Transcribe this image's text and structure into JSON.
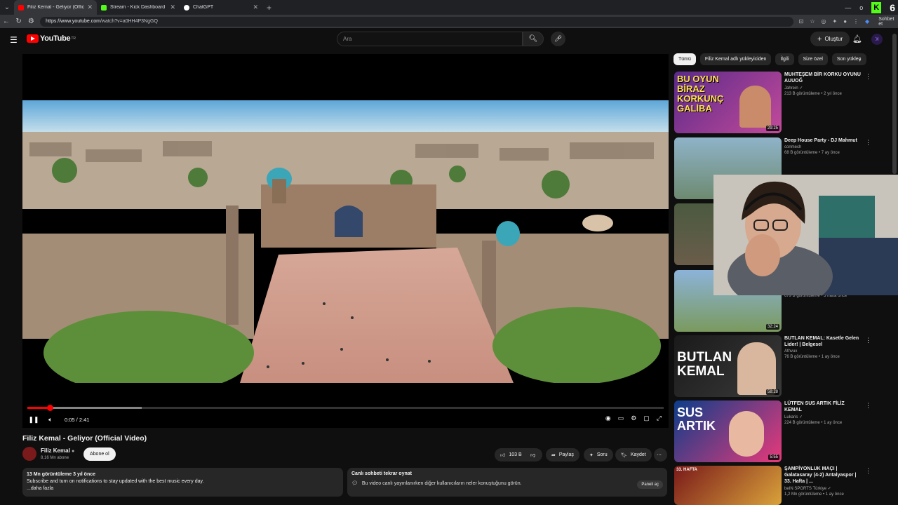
{
  "browser": {
    "tabs": [
      {
        "label": "Filiz Kemal - Geliyor (Official V",
        "fav": "#ff0000",
        "active": true
      },
      {
        "label": "Stream - Kick Dashboard",
        "fav": "#53fc18",
        "active": false
      },
      {
        "label": "ChatGPT",
        "fav": "#ffffff",
        "active": false
      }
    ],
    "url_domain": "https://www.youtube.com",
    "url_path": "/watch?v=a0HH4P3NgGQ",
    "profile_label": "Sohbet et",
    "kick_badge": "K",
    "counter": "6"
  },
  "header": {
    "logo_text": "YouTube",
    "logo_region": "TR",
    "search_placeholder": "Ara",
    "create_label": "Oluştur"
  },
  "player": {
    "time": "0:05 / 2:41",
    "progress_fraction": 0.035,
    "buffer_fraction": 0.18
  },
  "video": {
    "title": "Filiz Kemal - Geliyor (Official Video)",
    "channel": "Filiz Kemal",
    "subscribers": "8,16 Mn abone",
    "subscribe_label": "Abone ol",
    "likes": "103 B",
    "share_label": "Paylaş",
    "ask_label": "Soru",
    "save_label": "Kaydet"
  },
  "description": {
    "meta": "13 Mn görüntüleme  3 yıl önce",
    "text": "Subscribe and turn on notifications to stay updated with the best music every day.",
    "more": "...daha fazla"
  },
  "chat_replay": {
    "title": "Canlı sohbeti tekrar oynat",
    "text": "Bu video canlı yayınlanırken diğer kullanıcıların neler konuştuğunu görün.",
    "button": "Paneli aç"
  },
  "chips": [
    "Tümü",
    "Filiz Kemal adlı yükleyiciden",
    "İlgili",
    "Size özel",
    "Son yüklen"
  ],
  "recommendations": [
    {
      "title": "MUHTEŞEM BİR KORKU OYUNU AUUOĞ",
      "channel": "Jahrein ✓",
      "meta": "213 B görüntüleme • 2 yıl önce",
      "duration": "29:25",
      "thumb_text": "BU OYUN BİRAZ KORKUNÇ GALİBA"
    },
    {
      "title": "Deep House Party - DJ Mahmut",
      "channel": "conmech",
      "meta": "68 B görüntüleme • 7 ay önce",
      "duration": "",
      "thumb_text": ""
    },
    {
      "title": "",
      "channel": "",
      "meta": "679 B görüntüleme • 3 hafta önce",
      "duration": "32:24",
      "thumb_text": ""
    },
    {
      "title": "BUTLAN KEMAL: Kasetle Gelen Lider! | Belgesel",
      "channel": "Athvux",
      "meta": "76 B görüntüleme • 1 ay önce",
      "duration": "58:28",
      "thumb_text": "BUTLAN KEMAL"
    },
    {
      "title": "LÜTFEN SUS ARTIK FİLİZ KEMAL",
      "channel": "Lukaris ✓",
      "meta": "224 B görüntüleme • 1 ay önce",
      "duration": "5:55",
      "thumb_text": "SUS ARTIK"
    },
    {
      "title": "ŞAMPİYONLUK MAÇI | Galatasaray (4-2) Antalyaspor | 33. Hafta | ...",
      "channel": "beIN SPORTS Türkiye ✓",
      "meta": "1,2 Mn görüntüleme • 1 ay önce",
      "duration": "",
      "thumb_text": "33. HAFTA"
    }
  ],
  "icons": {
    "menu": "hamburger-icon",
    "search": "search-icon",
    "mic": "mic-icon",
    "bell": "bell-icon"
  },
  "colors": {
    "accent": "#ff0000",
    "kick": "#53fc18",
    "bg": "#0f0f0f"
  }
}
